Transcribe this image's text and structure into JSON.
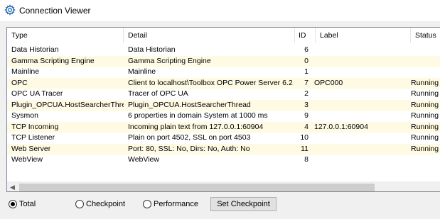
{
  "window": {
    "title": "Connection Viewer",
    "icon": "gear-icon"
  },
  "table": {
    "columns": [
      "Type",
      "Detail",
      "ID",
      "Label",
      "Status"
    ],
    "rows": [
      {
        "type": "Data Historian",
        "detail": "Data Historian",
        "id": "6",
        "label": "",
        "status": ""
      },
      {
        "type": "Gamma Scripting Engine",
        "detail": "Gamma Scripting Engine",
        "id": "0",
        "label": "",
        "status": ""
      },
      {
        "type": "Mainline",
        "detail": "Mainline",
        "id": "1",
        "label": "",
        "status": ""
      },
      {
        "type": "OPC",
        "detail": "Client to localhost\\Toolbox OPC Power Server 6.2",
        "id": "7",
        "label": "OPC000",
        "status": "Running"
      },
      {
        "type": "OPC UA Tracer",
        "detail": "Tracer of OPC UA",
        "id": "2",
        "label": "",
        "status": "Running"
      },
      {
        "type": "Plugin_OPCUA.HostSearcherThread",
        "detail": "Plugin_OPCUA.HostSearcherThread",
        "id": "3",
        "label": "",
        "status": "Running"
      },
      {
        "type": "Sysmon",
        "detail": "6 properties in domain System at 1000 ms",
        "id": "9",
        "label": "",
        "status": "Running"
      },
      {
        "type": "TCP Incoming",
        "detail": "Incoming plain text from 127.0.0.1:60904",
        "id": "4",
        "label": "127.0.0.1:60904",
        "status": "Running"
      },
      {
        "type": "TCP Listener",
        "detail": "Plain on port 4502, SSL on port 4503",
        "id": "10",
        "label": "",
        "status": "Running"
      },
      {
        "type": "Web Server",
        "detail": "Port: 80, SSL: No, Dirs: No, Auth: No",
        "id": "11",
        "label": "",
        "status": "Running"
      },
      {
        "type": "WebView",
        "detail": "WebView",
        "id": "8",
        "label": "",
        "status": ""
      }
    ]
  },
  "controls": {
    "radios": [
      {
        "label": "Total",
        "checked": true
      },
      {
        "label": "Checkpoint",
        "checked": false
      },
      {
        "label": "Performance",
        "checked": false
      }
    ],
    "button_label": "Set Checkpoint"
  },
  "colors": {
    "alt_row": "#fefae3",
    "title_icon": "#2b6cb8"
  }
}
